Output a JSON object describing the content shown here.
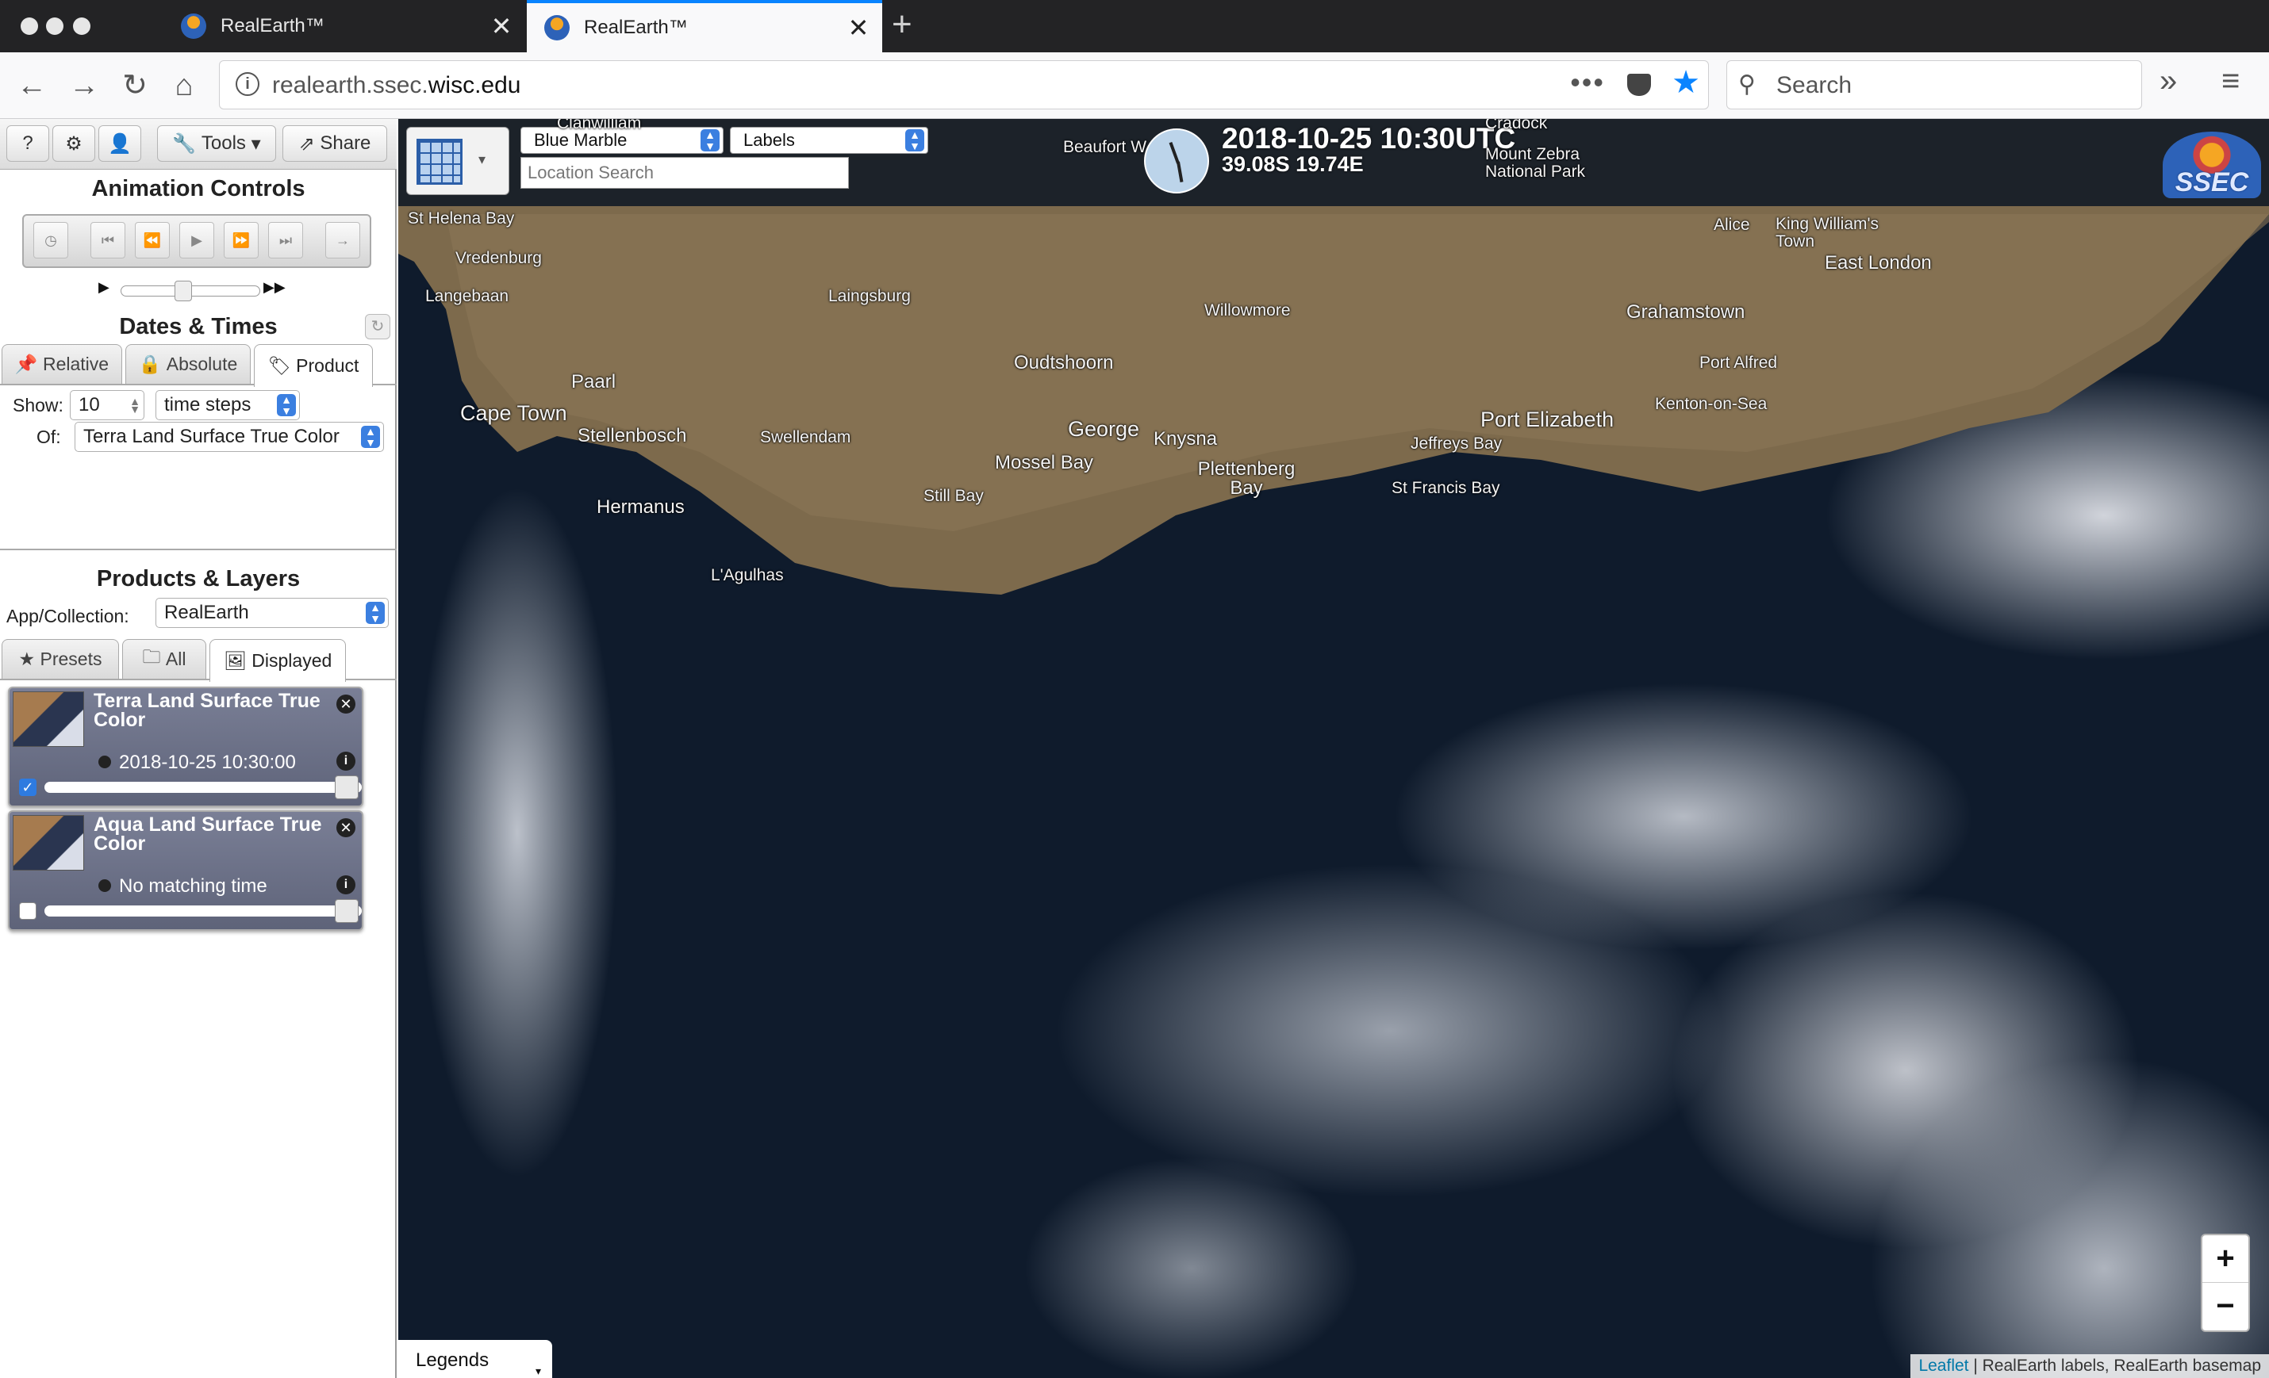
{
  "browser": {
    "tabs": [
      {
        "title": "RealEarth™",
        "active": false
      },
      {
        "title": "RealEarth™",
        "active": true
      }
    ],
    "url_prefix": "realearth.ssec.",
    "url_domain": "wisc.edu",
    "search_placeholder": "Search"
  },
  "toolbar": {
    "help": "?",
    "tools_label": "Tools",
    "share_label": "Share"
  },
  "animation": {
    "title": "Animation Controls"
  },
  "dates": {
    "title": "Dates & Times",
    "tabs": [
      "Relative",
      "Absolute",
      "Product"
    ],
    "selected_tab": "Product",
    "show_label": "Show:",
    "show_count": "10",
    "steps_label": "time steps",
    "of_label": "Of:",
    "of_value": "Terra Land Surface True Color"
  },
  "products": {
    "title": "Products & Layers",
    "app_label": "App/Collection:",
    "app_value": "RealEarth",
    "tabs": [
      "Presets",
      "All",
      "Displayed"
    ],
    "selected_tab": "Displayed",
    "layers": [
      {
        "title": "Terra Land Surface True Color",
        "time": "2018-10-25 10:30:00",
        "checked": true
      },
      {
        "title": "Aqua Land Surface True Color",
        "time": "No matching time",
        "checked": false
      }
    ]
  },
  "map": {
    "basemap": "Blue Marble",
    "labels": "Labels",
    "location_placeholder": "Location Search",
    "datetime": "2018-10-25 10:30UTC",
    "coords": "39.08S 19.74E",
    "logo_text": "SSEC",
    "legends_label": "Legends",
    "attribution_link": "Leaflet",
    "attribution_text": " | RealEarth labels, RealEarth basemap",
    "places": [
      "Clanwilliam",
      "Beaufort W",
      "Cradock",
      "Mount Zebra National Park",
      "St Helena Bay",
      "Vredenburg",
      "Langebaan",
      "Laingsburg",
      "Willowmore",
      "Alice",
      "King William's Town",
      "East London",
      "Grahamstown",
      "Paarl",
      "Oudtshoorn",
      "Port Alfred",
      "Kenton-on-Sea",
      "Cape Town",
      "Stellenbosch",
      "Swellendam",
      "George",
      "Knysna",
      "Port Elizabeth",
      "Jeffreys Bay",
      "Mossel Bay",
      "Plettenberg Bay",
      "St Francis Bay",
      "Hermanus",
      "Still Bay",
      "L'Agulhas"
    ]
  },
  "colors": {
    "accent": "#0a84ff",
    "ocean": "#0f1b2c",
    "land": "#7d6a4c"
  }
}
